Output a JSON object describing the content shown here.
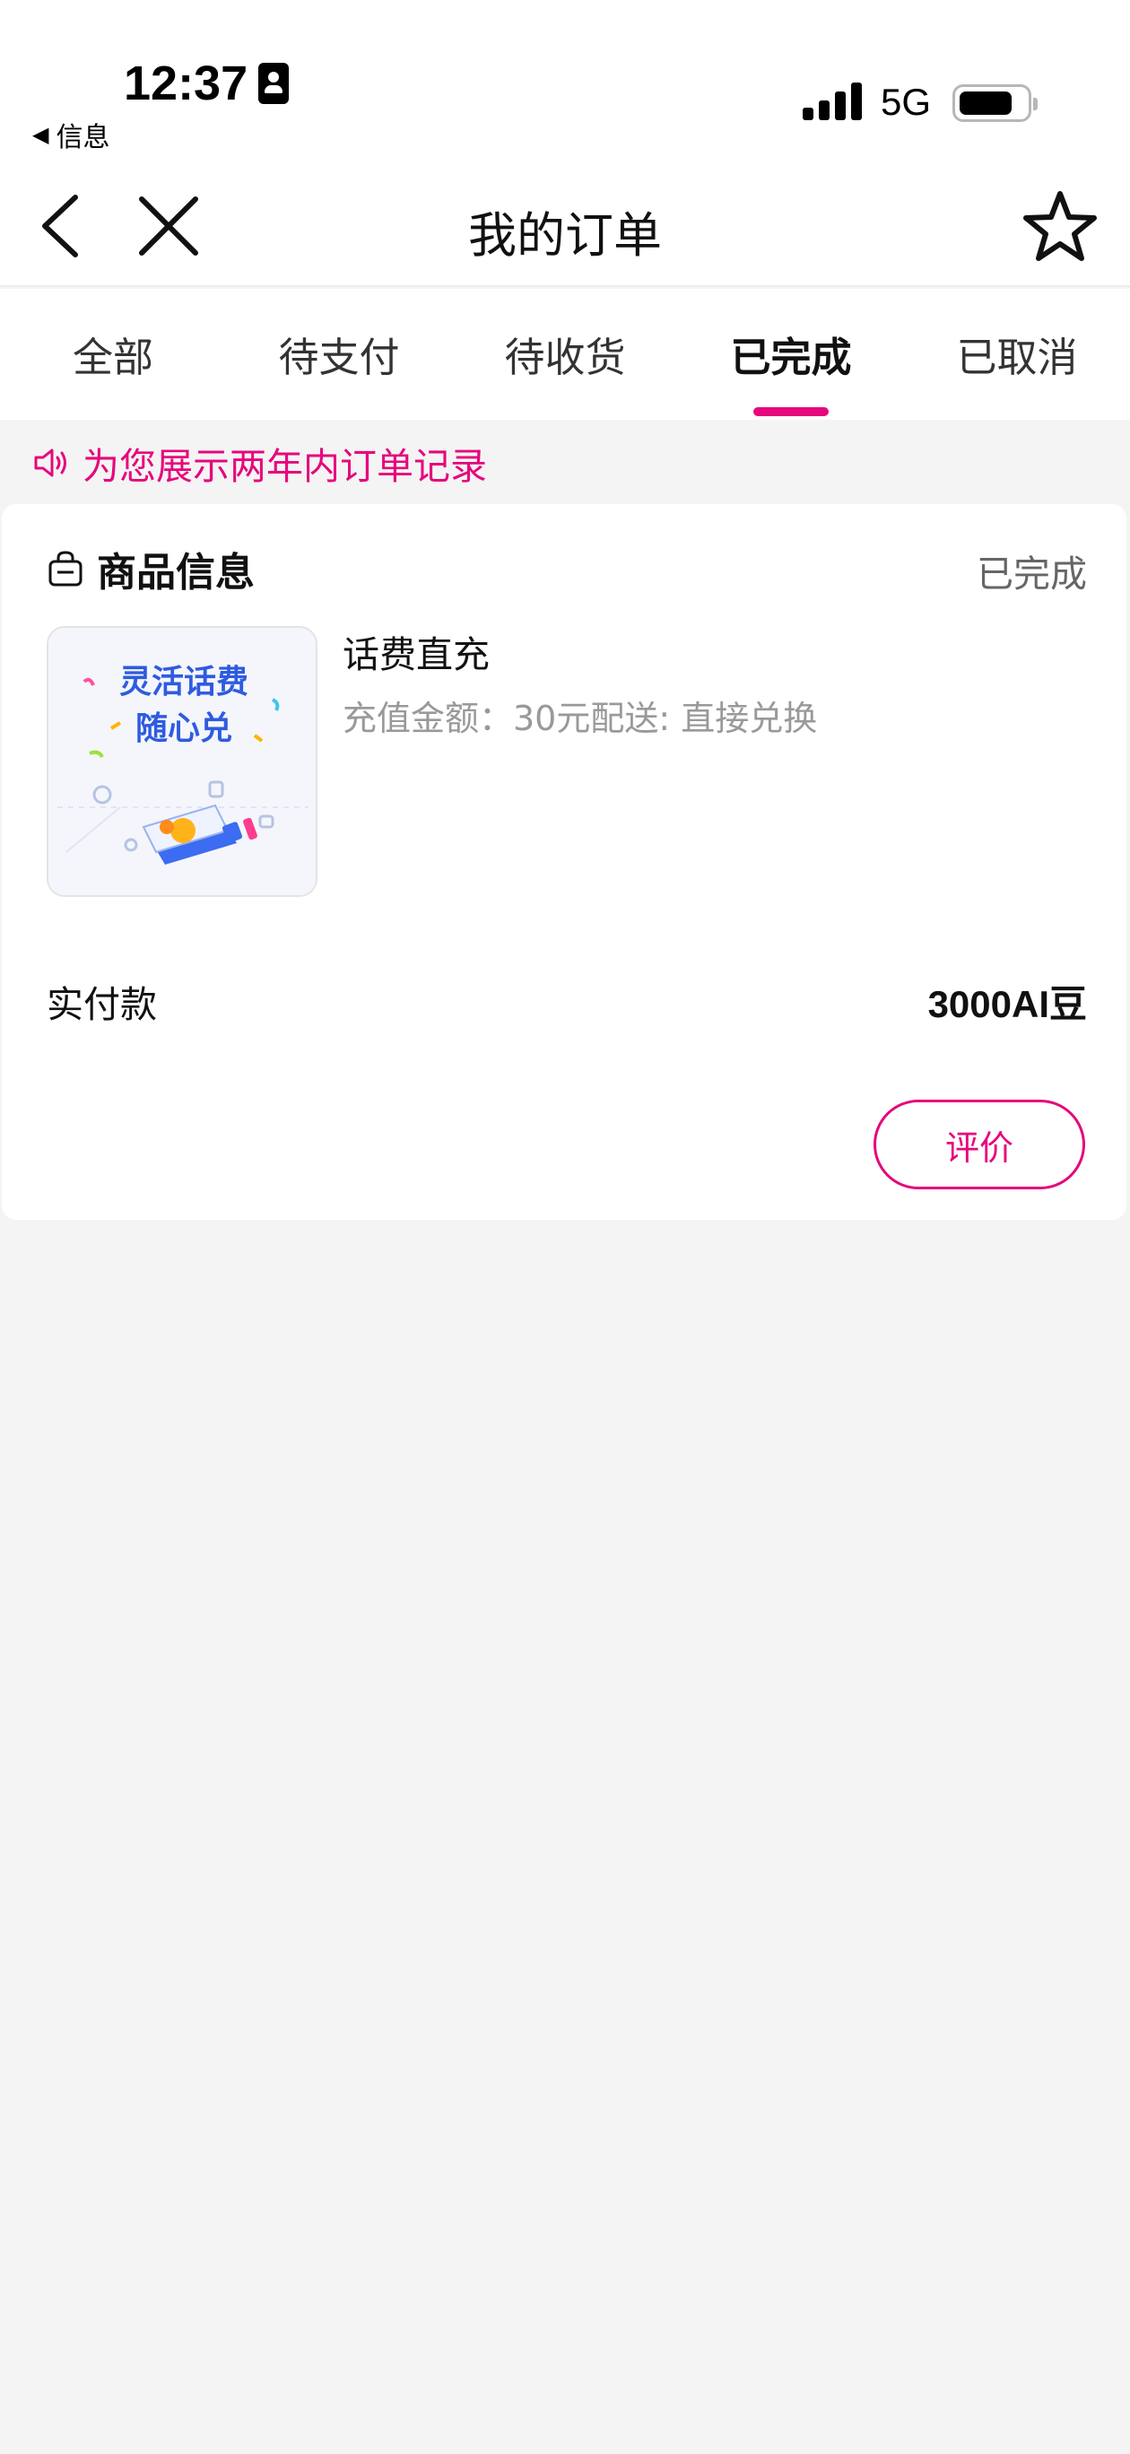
{
  "status_bar": {
    "time": "12:37",
    "back_app": "信息",
    "network": "5G"
  },
  "nav": {
    "title": "我的订单",
    "icons": [
      "back-icon",
      "close-icon",
      "star-icon"
    ]
  },
  "tabs": [
    {
      "label": "全部",
      "active": false
    },
    {
      "label": "待支付",
      "active": false
    },
    {
      "label": "待收货",
      "active": false
    },
    {
      "label": "已完成",
      "active": true
    },
    {
      "label": "已取消",
      "active": false
    }
  ],
  "notice": "为您展示两年内订单记录",
  "order": {
    "section_title": "商品信息",
    "status": "已完成",
    "product": {
      "image_text_line1": "灵活话费",
      "image_text_line2": "随心兑",
      "title": "话费直充",
      "desc": "充值金额：30元配送: 直接兑换"
    },
    "paid_label": "实付款",
    "paid_value": "3000AI豆",
    "review_button": "评价"
  },
  "colors": {
    "accent": "#e6077c",
    "background": "#f4f4f4",
    "text_muted": "#999999"
  }
}
